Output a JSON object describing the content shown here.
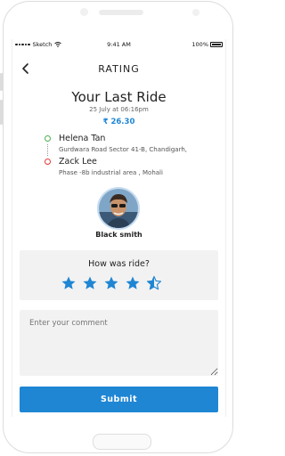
{
  "status_bar": {
    "carrier": "Sketch",
    "time": "9:41 AM",
    "battery": "100%"
  },
  "header": {
    "title": "RATING"
  },
  "ride": {
    "title": "Your Last Ride",
    "date": "25 July at 06:16pm",
    "fare": "₹ 26.30"
  },
  "route": {
    "pickup_name": "Helena Tan",
    "pickup_address": "Gurdwara Road Sector 41-B, Chandigarh,",
    "drop_name": "Zack Lee",
    "drop_address": "Phase -8b industrial area , Mohali"
  },
  "driver": {
    "name": "Black smith"
  },
  "rating": {
    "question": "How was ride?",
    "value": 4.5,
    "max": 5
  },
  "comment": {
    "placeholder": "Enter your comment",
    "value": ""
  },
  "submit_label": "Submit",
  "colors": {
    "accent": "#1f86d4",
    "pickup": "#4caf50",
    "drop": "#e53935",
    "card": "#f2f2f2"
  }
}
